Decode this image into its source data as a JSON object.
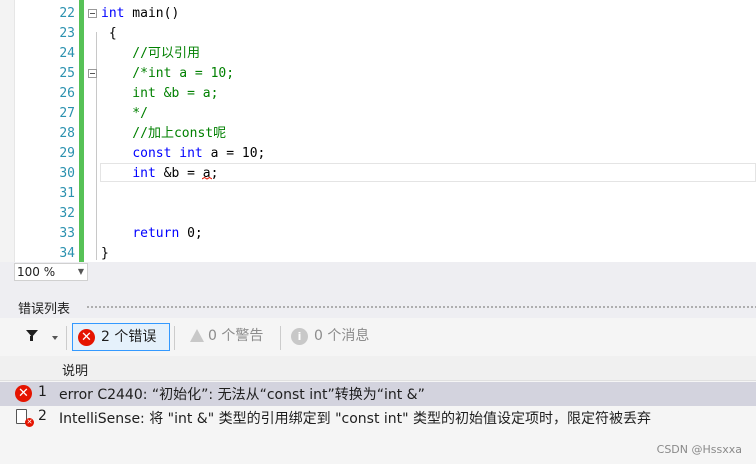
{
  "editor": {
    "lines": [
      {
        "num": "22",
        "text": ""
      },
      {
        "num": "23",
        "text": " {"
      },
      {
        "num": "24",
        "text": "    //可以引用"
      },
      {
        "num": "25",
        "text": "    /*int a = 10;"
      },
      {
        "num": "26",
        "text": "    int &b = a;"
      },
      {
        "num": "27",
        "text": "    */"
      },
      {
        "num": "28",
        "text": "    //加上const呢"
      },
      {
        "num": "29",
        "text": ""
      },
      {
        "num": "30",
        "text": ""
      },
      {
        "num": "31",
        "text": ""
      },
      {
        "num": "32",
        "text": ""
      },
      {
        "num": "33",
        "text": ""
      },
      {
        "num": "34",
        "text": "}"
      }
    ],
    "line22_kw": "int",
    "line22_rest": " main()",
    "line29_kw1": "const",
    "line29_kw2": "int",
    "line29_rest": " a = 10;",
    "line30_kw": "int",
    "line30_rest": " &b = a;",
    "line33_kw": "return",
    "line33_rest": " 0;"
  },
  "zoom": {
    "value": "100 %"
  },
  "error_list": {
    "title": "错误列表",
    "errors_button": "2 个错误",
    "warnings_button": "0 个警告",
    "messages_button": "0 个消息",
    "column_header": "说明",
    "rows": [
      {
        "index": "1",
        "description": "error C2440: “初始化”: 无法从“const int”转换为“int &”",
        "icon": "error-icon"
      },
      {
        "index": "2",
        "description": "IntelliSense: 将 \"int &\" 类型的引用绑定到 \"const int\" 类型的初始值设定项时，限定符被丢弃",
        "icon": "intellisense-error-icon"
      }
    ]
  },
  "watermark": "CSDN @Hssxxa",
  "colors": {
    "keyword": "#0000ff",
    "comment": "#008000",
    "line_number": "#2b91af",
    "change_bar": "#57c257",
    "error": "#e51400"
  }
}
